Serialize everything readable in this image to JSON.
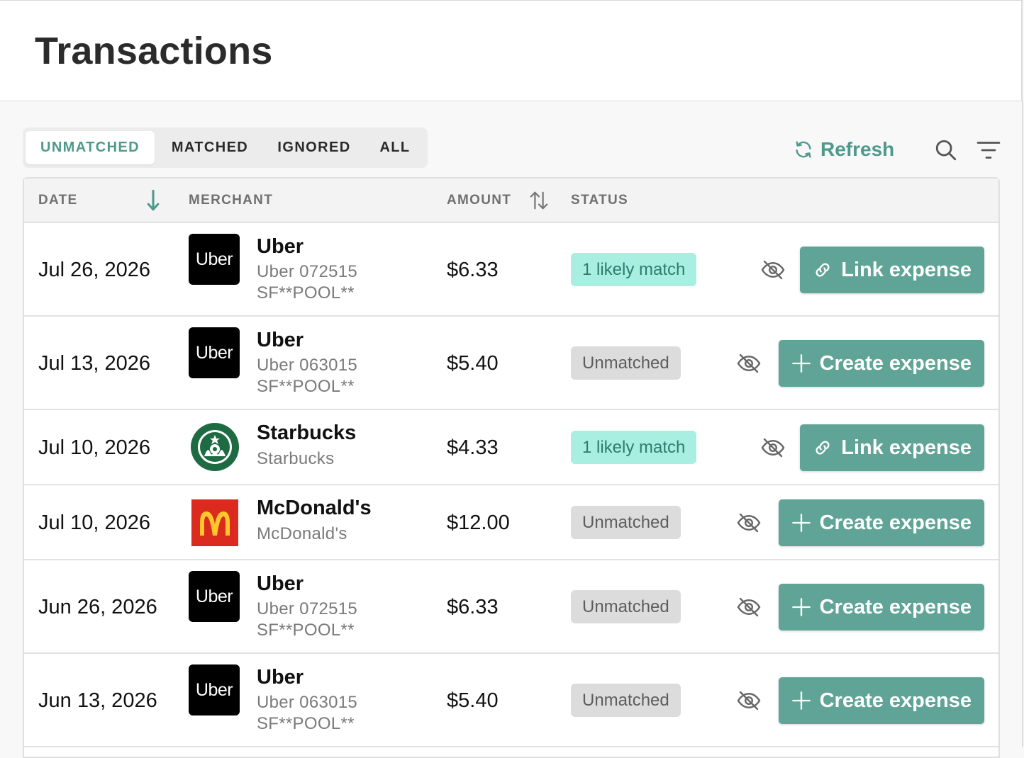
{
  "header": {
    "title": "Transactions"
  },
  "tabs": [
    {
      "label": "UNMATCHED",
      "active": true
    },
    {
      "label": "MATCHED",
      "active": false
    },
    {
      "label": "IGNORED",
      "active": false
    },
    {
      "label": "ALL",
      "active": false
    }
  ],
  "toolbar": {
    "refresh_label": "Refresh",
    "search_icon": "search-icon",
    "filter_icon": "filter-icon"
  },
  "table": {
    "columns": {
      "date": "DATE",
      "merchant": "MERCHANT",
      "amount": "AMOUNT",
      "status": "STATUS"
    },
    "rows": [
      {
        "date": "Jul 26, 2026",
        "logo": "uber",
        "logo_text": "Uber",
        "merchant": "Uber",
        "description": "Uber 072515 SF**POOL**",
        "amount": "$6.33",
        "status": "1 likely match",
        "status_type": "likely",
        "action": "Link expense",
        "action_icon": "link-icon"
      },
      {
        "date": "Jul 13, 2026",
        "logo": "uber",
        "logo_text": "Uber",
        "merchant": "Uber",
        "description": "Uber 063015 SF**POOL**",
        "amount": "$5.40",
        "status": "Unmatched",
        "status_type": "unmatched",
        "action": "Create expense",
        "action_icon": "plus-icon"
      },
      {
        "date": "Jul 10, 2026",
        "logo": "starbucks",
        "logo_text": "",
        "merchant": "Starbucks",
        "description": "Starbucks",
        "amount": "$4.33",
        "status": "1 likely match",
        "status_type": "likely",
        "action": "Link expense",
        "action_icon": "link-icon"
      },
      {
        "date": "Jul 10, 2026",
        "logo": "mcdonalds",
        "logo_text": "",
        "merchant": "McDonald's",
        "description": "McDonald's",
        "amount": "$12.00",
        "status": "Unmatched",
        "status_type": "unmatched",
        "action": "Create expense",
        "action_icon": "plus-icon"
      },
      {
        "date": "Jun 26, 2026",
        "logo": "uber",
        "logo_text": "Uber",
        "merchant": "Uber",
        "description": "Uber 072515 SF**POOL**",
        "amount": "$6.33",
        "status": "Unmatched",
        "status_type": "unmatched",
        "action": "Create expense",
        "action_icon": "plus-icon"
      },
      {
        "date": "Jun 13, 2026",
        "logo": "uber",
        "logo_text": "Uber",
        "merchant": "Uber",
        "description": "Uber 063015 SF**POOL**",
        "amount": "$5.40",
        "status": "Unmatched",
        "status_type": "unmatched",
        "action": "Create expense",
        "action_icon": "plus-icon"
      }
    ]
  },
  "colors": {
    "accent": "#4d9a8c",
    "button": "#5fa496",
    "likely_badge_bg": "#a8efe2",
    "unmatched_badge_bg": "#dcdcdc",
    "mcdonalds_red": "#db2a1e",
    "starbucks_green": "#1e6b43"
  }
}
